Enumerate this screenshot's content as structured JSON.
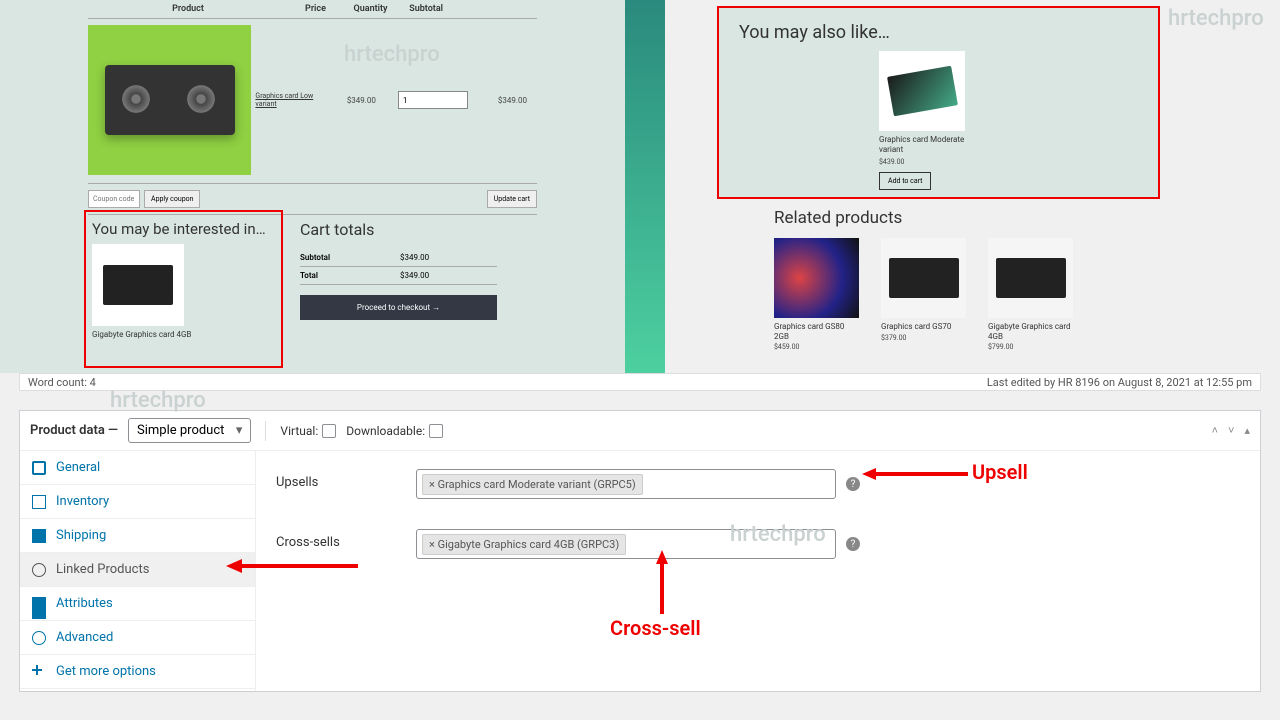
{
  "cart": {
    "header": {
      "product": "Product",
      "price": "Price",
      "qty": "Quantity",
      "subtotal": "Subtotal"
    },
    "item": {
      "name": "Graphics card Low variant",
      "price": "$349.00",
      "qty": "1",
      "subtotal": "$349.00"
    },
    "coupon_placeholder": "Coupon code",
    "apply_coupon": "Apply coupon",
    "update_cart": "Update cart"
  },
  "interested": {
    "title": "You may be interested in…",
    "product": "Gigabyte Graphics card 4GB"
  },
  "totals": {
    "title": "Cart totals",
    "subtotal_lbl": "Subtotal",
    "subtotal": "$349.00",
    "total_lbl": "Total",
    "total": "$349.00",
    "checkout": "Proceed to checkout →"
  },
  "alsolike": {
    "title": "You may also like…",
    "name": "Graphics card Moderate variant",
    "price": "$439.00",
    "add": "Add to cart"
  },
  "related": {
    "title": "Related products",
    "items": [
      {
        "name": "Graphics card GS80 2GB",
        "price": "$459.00"
      },
      {
        "name": "Graphics card GS70",
        "price": "$379.00"
      },
      {
        "name": "Gigabyte Graphics card 4GB",
        "price": "$799.00"
      }
    ]
  },
  "status": {
    "wordcount": "Word count: 4",
    "lastedit": "Last edited by HR 8196 on August 8, 2021 at 12:55 pm"
  },
  "panel": {
    "title": "Product data —",
    "type": "Simple product",
    "virtual": "Virtual:",
    "downloadable": "Downloadable:"
  },
  "tabs": {
    "general": "General",
    "inventory": "Inventory",
    "shipping": "Shipping",
    "linked": "Linked Products",
    "attributes": "Attributes",
    "advanced": "Advanced",
    "getmore": "Get more options"
  },
  "fields": {
    "upsells": "Upsells",
    "upsells_tag": "× Graphics card Moderate variant (GRPC5)",
    "crosssells": "Cross-sells",
    "crosssells_tag": "× Gigabyte Graphics card 4GB (GRPC3)"
  },
  "annot": {
    "upsell": "Upsell",
    "crosssell": "Cross-sell"
  },
  "watermark": "hrtechpro"
}
